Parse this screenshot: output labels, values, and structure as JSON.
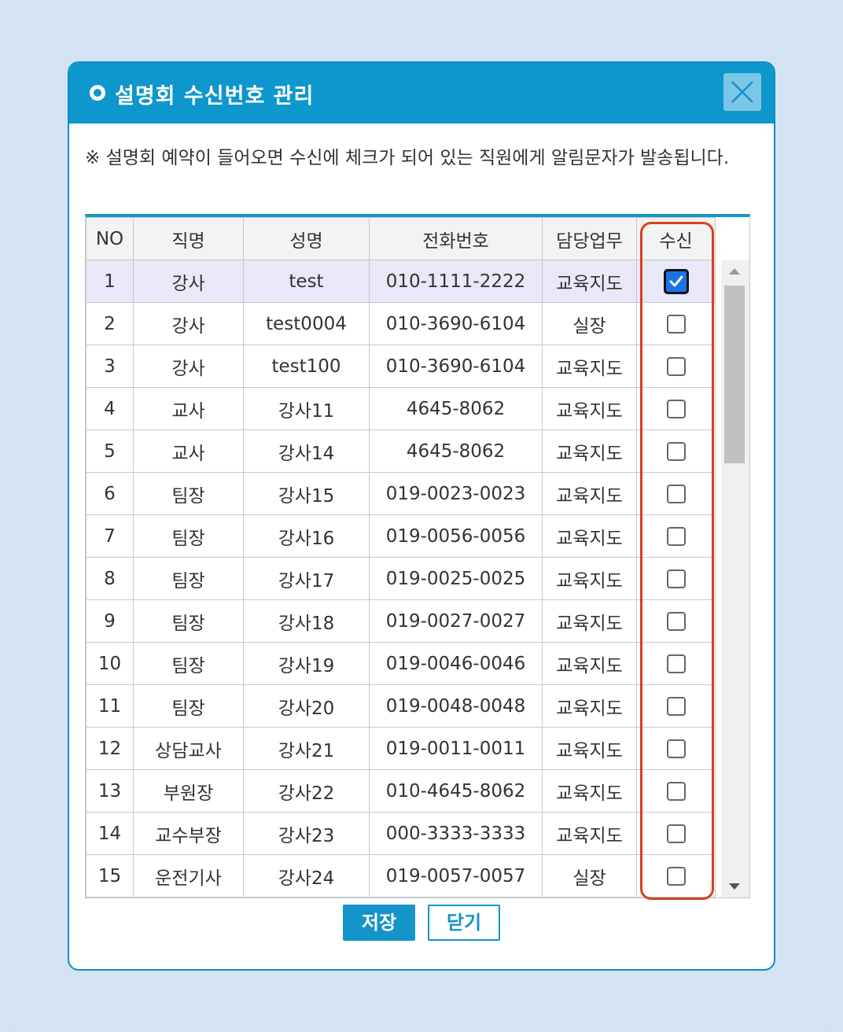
{
  "dialog": {
    "title": "설명회 수신번호 관리",
    "notice": "※ 설명회 예약이 들어오면 수신에 체크가 되어 있는 직원에게 알림문자가 발송됩니다."
  },
  "table": {
    "headers": {
      "no": "NO",
      "position": "직명",
      "name": "성명",
      "phone": "전화번호",
      "duty": "담당업무",
      "receive": "수신"
    },
    "rows": [
      {
        "no": "1",
        "position": "강사",
        "name": "test",
        "phone": "010-1111-2222",
        "duty": "교육지도",
        "receive": true
      },
      {
        "no": "2",
        "position": "강사",
        "name": "test0004",
        "phone": "010-3690-6104",
        "duty": "실장",
        "receive": false
      },
      {
        "no": "3",
        "position": "강사",
        "name": "test100",
        "phone": "010-3690-6104",
        "duty": "교육지도",
        "receive": false
      },
      {
        "no": "4",
        "position": "교사",
        "name": "강사11",
        "phone": "4645-8062",
        "duty": "교육지도",
        "receive": false
      },
      {
        "no": "5",
        "position": "교사",
        "name": "강사14",
        "phone": "4645-8062",
        "duty": "교육지도",
        "receive": false
      },
      {
        "no": "6",
        "position": "팀장",
        "name": "강사15",
        "phone": "019-0023-0023",
        "duty": "교육지도",
        "receive": false
      },
      {
        "no": "7",
        "position": "팀장",
        "name": "강사16",
        "phone": "019-0056-0056",
        "duty": "교육지도",
        "receive": false
      },
      {
        "no": "8",
        "position": "팀장",
        "name": "강사17",
        "phone": "019-0025-0025",
        "duty": "교육지도",
        "receive": false
      },
      {
        "no": "9",
        "position": "팀장",
        "name": "강사18",
        "phone": "019-0027-0027",
        "duty": "교육지도",
        "receive": false
      },
      {
        "no": "10",
        "position": "팀장",
        "name": "강사19",
        "phone": "019-0046-0046",
        "duty": "교육지도",
        "receive": false
      },
      {
        "no": "11",
        "position": "팀장",
        "name": "강사20",
        "phone": "019-0048-0048",
        "duty": "교육지도",
        "receive": false
      },
      {
        "no": "12",
        "position": "상담교사",
        "name": "강사21",
        "phone": "019-0011-0011",
        "duty": "교육지도",
        "receive": false
      },
      {
        "no": "13",
        "position": "부원장",
        "name": "강사22",
        "phone": "010-4645-8062",
        "duty": "교육지도",
        "receive": false
      },
      {
        "no": "14",
        "position": "교수부장",
        "name": "강사23",
        "phone": "000-3333-3333",
        "duty": "교육지도",
        "receive": false
      },
      {
        "no": "15",
        "position": "운전기사",
        "name": "강사24",
        "phone": "019-0057-0057",
        "duty": "실장",
        "receive": false
      }
    ]
  },
  "buttons": {
    "save": "저장",
    "close": "닫기"
  },
  "colors": {
    "accent": "#0d97cc",
    "highlight": "#d9401e",
    "background": "#d3e3f3"
  }
}
